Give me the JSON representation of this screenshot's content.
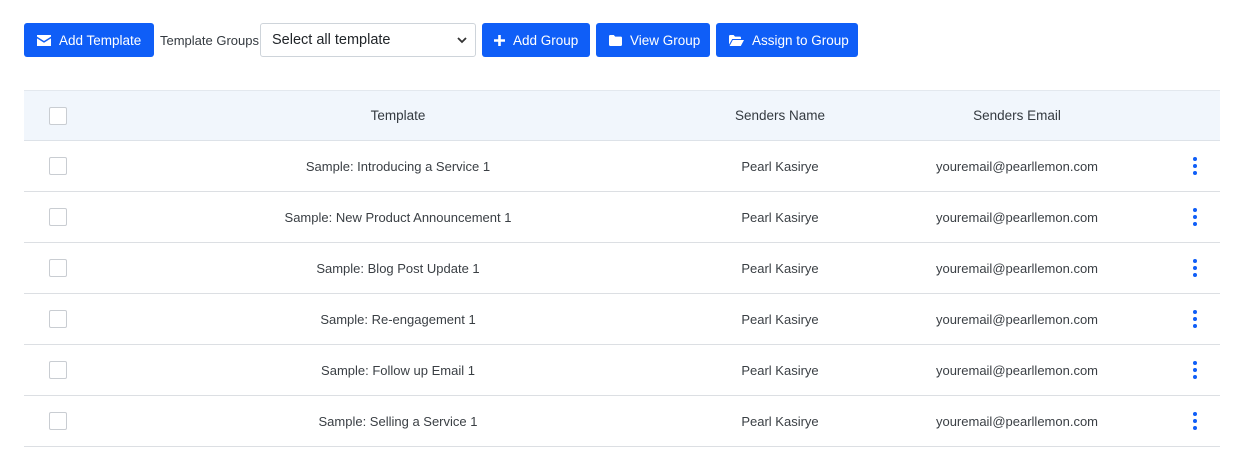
{
  "toolbar": {
    "add_template_label": "Add Template",
    "template_groups_label": "Template Groups",
    "select_value": "Select all template",
    "add_group_label": "Add Group",
    "view_group_label": "View Group",
    "assign_to_group_label": "Assign to Group"
  },
  "table": {
    "headers": {
      "template": "Template",
      "senders_name": "Senders Name",
      "senders_email": "Senders Email"
    },
    "rows": [
      {
        "template": "Sample: Introducing a Service 1",
        "name": "Pearl Kasirye",
        "email": "youremail@pearllemon.com"
      },
      {
        "template": "Sample: New Product Announcement 1",
        "name": "Pearl Kasirye",
        "email": "youremail@pearllemon.com"
      },
      {
        "template": "Sample: Blog Post Update 1",
        "name": "Pearl Kasirye",
        "email": "youremail@pearllemon.com"
      },
      {
        "template": "Sample: Re-engagement 1",
        "name": "Pearl Kasirye",
        "email": "youremail@pearllemon.com"
      },
      {
        "template": "Sample: Follow up Email 1",
        "name": "Pearl Kasirye",
        "email": "youremail@pearllemon.com"
      },
      {
        "template": "Sample: Selling a Service 1",
        "name": "Pearl Kasirye",
        "email": "youremail@pearllemon.com"
      }
    ]
  },
  "icons": {
    "add_template": "envelope-icon",
    "add_group": "plus-icon",
    "view_group": "folder-icon",
    "assign_to_group": "folder-open-icon",
    "row_menu": "vertical-ellipsis-icon",
    "select": "chevron-down-icon"
  },
  "colors": {
    "primary": "#0f5ef7",
    "header_bg": "#f1f6fc",
    "text": "#343a40"
  }
}
